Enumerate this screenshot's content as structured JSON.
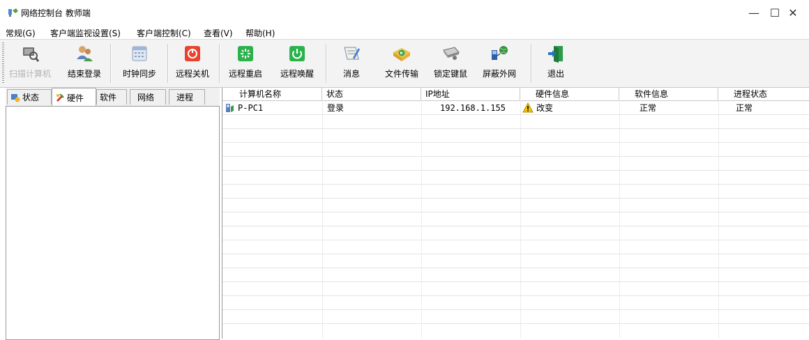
{
  "window": {
    "title": "网络控制台 教师端",
    "minimize_glyph": "—",
    "maximize_glyph": "☐",
    "close_glyph": "✕"
  },
  "menu": [
    "常规(G)",
    "客户端监视设置(S)",
    "客户端控制(C)",
    "查看(V)",
    "帮助(H)"
  ],
  "toolbar": {
    "buttons": [
      {
        "label": "扫描计算机",
        "icon": "scan-computer-icon",
        "enabled": false
      },
      {
        "label": "结束登录",
        "icon": "end-login-users-icon",
        "enabled": true
      },
      {
        "label": "时钟同步",
        "icon": "clock-sync-icon",
        "enabled": true
      },
      {
        "label": "远程关机",
        "icon": "remote-shutdown-icon",
        "enabled": true
      },
      {
        "label": "远程重启",
        "icon": "remote-restart-icon",
        "enabled": true
      },
      {
        "label": "远程唤醒",
        "icon": "remote-wake-icon",
        "enabled": true
      },
      {
        "label": "消息",
        "icon": "message-icon",
        "enabled": true
      },
      {
        "label": "文件传输",
        "icon": "file-transfer-icon",
        "enabled": true
      },
      {
        "label": "锁定键鼠",
        "icon": "lock-keyboard-mouse-icon",
        "enabled": true
      },
      {
        "label": "屏蔽外网",
        "icon": "block-internet-icon",
        "enabled": true
      },
      {
        "label": "退出",
        "icon": "exit-icon",
        "enabled": true
      }
    ]
  },
  "left_tabs": [
    {
      "label": "状态",
      "icon": "status-icon"
    },
    {
      "label": "硬件",
      "icon": "hardware-icon",
      "active": true
    },
    {
      "label": "软件"
    },
    {
      "label": "网络"
    },
    {
      "label": "进程"
    }
  ],
  "table": {
    "columns": [
      "计算机名称",
      "状态",
      "IP地址",
      "硬件信息",
      "软件信息",
      "进程状态"
    ],
    "rows": [
      {
        "name": "P-PC1",
        "status": "登录",
        "ip": "192.168.1.155",
        "hardware": "改变",
        "hardware_icon": "warning-icon",
        "software": "正常",
        "process": "正常"
      }
    ]
  },
  "colors": {
    "shutdown": "#e8432e",
    "restart": "#2bb24c",
    "wake": "#2bb24c",
    "warning": "#f4c400"
  }
}
